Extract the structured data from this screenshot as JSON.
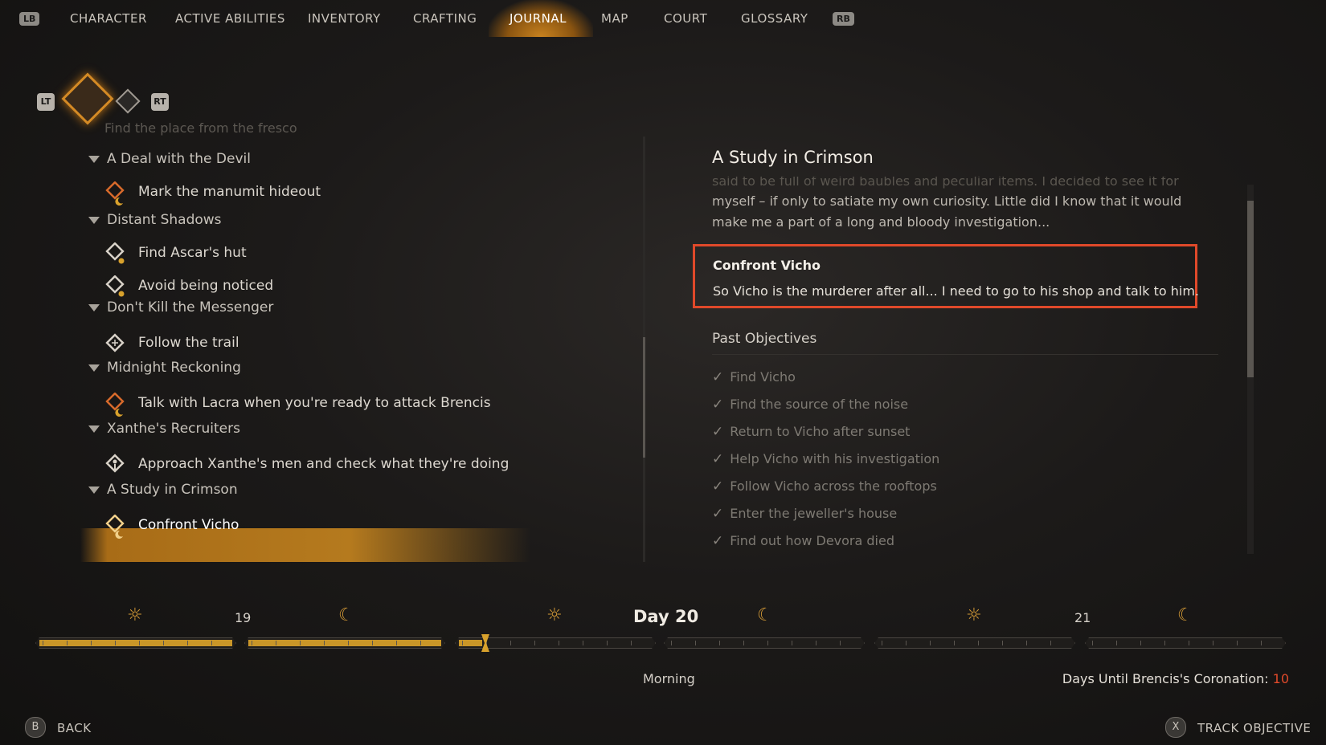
{
  "nav": {
    "lb": "LB",
    "rb": "RB",
    "tabs": [
      {
        "label": "CHARACTER"
      },
      {
        "label": "ACTIVE ABILITIES"
      },
      {
        "label": "INVENTORY"
      },
      {
        "label": "CRAFTING"
      },
      {
        "label": "JOURNAL"
      },
      {
        "label": "MAP"
      },
      {
        "label": "COURT"
      },
      {
        "label": "GLOSSARY"
      }
    ],
    "active_tab": "JOURNAL"
  },
  "filter": {
    "lt": "LT",
    "rt": "RT"
  },
  "quest_list": {
    "faded_top": "Find the place from the fresco",
    "quests": [
      {
        "title": "A Deal with the Devil",
        "objectives": [
          {
            "text": "Mark the manumit hideout",
            "icon": "diamond-moon-orange-icon"
          }
        ]
      },
      {
        "title": "Distant Shadows",
        "objectives": [
          {
            "text": "Find Ascar's hut",
            "icon": "diamond-sun-icon"
          },
          {
            "text": "Avoid being noticed",
            "icon": "diamond-sun-icon"
          }
        ]
      },
      {
        "title": "Don't Kill the Messenger",
        "objectives": [
          {
            "text": "Follow the trail",
            "icon": "diamond-icon"
          }
        ]
      },
      {
        "title": "Midnight Reckoning",
        "objectives": [
          {
            "text": "Talk with Lacra when you're ready to attack Brencis",
            "icon": "diamond-moon-orange-icon"
          }
        ]
      },
      {
        "title": "Xanthe's Recruiters",
        "objectives": [
          {
            "text": "Approach Xanthe's men and check what they're doing",
            "icon": "diamond-figure-icon"
          }
        ]
      },
      {
        "title": "A Study in Crimson",
        "objectives": [
          {
            "text": "Confront Vicho",
            "icon": "diamond-moon-gold-icon",
            "selected": true
          }
        ]
      }
    ]
  },
  "detail": {
    "title": "A Study in Crimson",
    "clipped_line": "said to be full of weird baubles and peculiar items. I decided to see it for",
    "body": "myself – if only to satiate my own curiosity. Little did I know that it would make me a part of a long and bloody investigation...",
    "current_objective": {
      "title": "Confront Vicho",
      "desc": "So Vicho is the murderer after all... I need to go to his shop and talk to him."
    },
    "past_label": "Past Objectives",
    "past_objectives": [
      "Find Vicho",
      "Find the source of the noise",
      "Return to Vicho after sunset",
      "Help Vicho with his investigation",
      "Follow Vicho across the rooftops",
      "Enter the jeweller's house",
      "Find out how Devora died"
    ]
  },
  "timeline": {
    "day_prev": "19",
    "day_current": "Day 20",
    "day_next": "21",
    "time_of_day": "Morning",
    "sun_icon": "sun-icon",
    "moon_icon": "moon-icon",
    "segments_fill": [
      1,
      1,
      0.12,
      0,
      0,
      0
    ],
    "accent": "#c99628"
  },
  "coronation": {
    "label": "Days Until Brencis's Coronation:",
    "value": "10",
    "value_color": "#e0492a"
  },
  "footer": {
    "back_key": "B",
    "back_label": "BACK",
    "track_key": "X",
    "track_label": "TRACK OBJECTIVE"
  }
}
